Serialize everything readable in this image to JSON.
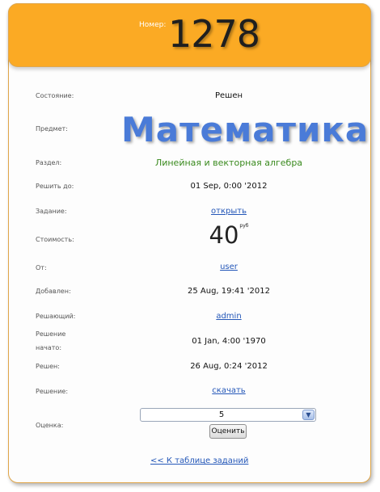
{
  "header": {
    "number_label": "Номер:",
    "number": "1278",
    "background": "#fbaa24"
  },
  "fields": {
    "status_label": "Состояние:",
    "status": "Решен",
    "subject_label": "Предмет:",
    "subject": "Математика",
    "section_label": "Раздел:",
    "section": "Линейная и векторная алгебра",
    "deadline_label": "Решить до:",
    "deadline": "01 Sep, 0:00 '2012",
    "task_label": "Задание:",
    "task_link": "открыть",
    "cost_label": "Стоимость:",
    "cost": "40",
    "cost_currency": "руб",
    "from_label": "От:",
    "from_user": "user",
    "added_label": "Добавлен:",
    "added": "25 Aug, 19:41 '2012",
    "solver_label": "Решающий:",
    "solver": "admin",
    "started_label_1": "Решение",
    "started_label_2": "начато:",
    "started": "01 Jan, 4:00 '1970",
    "solved_label": "Решен:",
    "solved": "26 Aug, 0:24 '2012",
    "solution_label": "Решение:",
    "solution_link": "скачать",
    "rating_label": "Оценка:",
    "rating_selected": "5",
    "rating_button": "Оценить"
  },
  "footer": {
    "back_link": "<< К таблице заданий"
  },
  "colors": {
    "accent": "#fbaa24",
    "link": "#2457b8",
    "subject": "#4a7bd8",
    "section": "#3a8a1e"
  }
}
